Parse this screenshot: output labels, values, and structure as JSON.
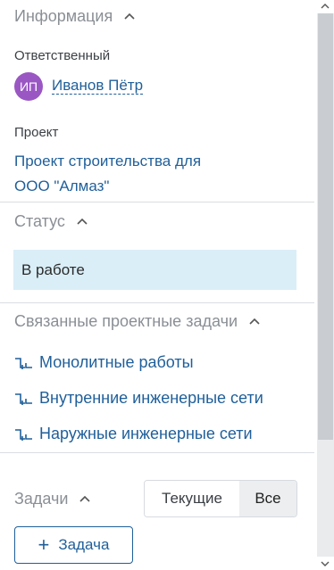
{
  "info": {
    "header": "Информация",
    "responsible_label": "Ответственный",
    "avatar_initials": "ИП",
    "avatar_color": "#9a57c3",
    "responsible_name": "Иванов Пётр",
    "project_label": "Проект",
    "project_line1": "Проект строительства для",
    "project_line2": "ООО \"Алмаз\""
  },
  "status": {
    "header": "Статус",
    "value": "В работе"
  },
  "related": {
    "header": "Связанные проектные задачи",
    "items": [
      {
        "label": "Монолитные работы"
      },
      {
        "label": "Внутренние инженерные сети"
      },
      {
        "label": "Наружные инженерные сети"
      }
    ]
  },
  "tasks": {
    "header": "Задачи",
    "filter_current": "Текущие",
    "filter_all": "Все",
    "add_button": "Задача"
  },
  "colors": {
    "link": "#1f5f9a",
    "status_bg": "#daeef7"
  }
}
